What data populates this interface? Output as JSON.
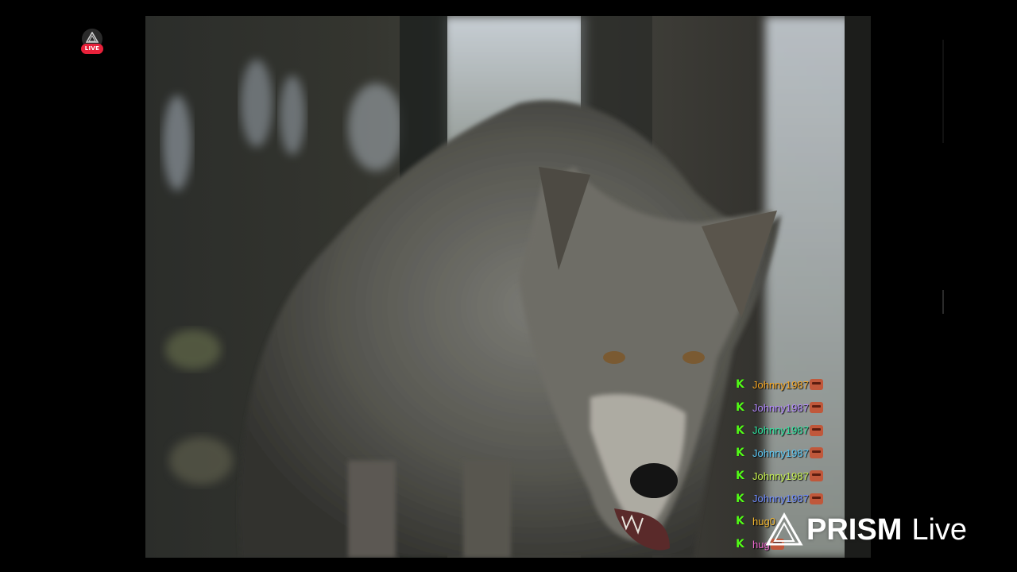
{
  "live_badge": {
    "label": "LIVE",
    "color": "#e8213a"
  },
  "video": {
    "subject": "wolf-in-forest"
  },
  "chat": {
    "platform_icon": "kick-icon",
    "messages": [
      {
        "user": "Johnny1987",
        "color": "#f5a623",
        "text": "",
        "emote": true
      },
      {
        "user": "Johnny1987",
        "color": "#b388ff",
        "text": "",
        "emote": true
      },
      {
        "user": "Johnny1987",
        "color": "#2ee6a0",
        "text": "",
        "emote": true
      },
      {
        "user": "Johnny1987",
        "color": "#5bc8f5",
        "text": "",
        "emote": true
      },
      {
        "user": "Johnny1987",
        "color": "#c6f24e",
        "text": "",
        "emote": true
      },
      {
        "user": "Johnny1987",
        "color": "#6f8cff",
        "text": "",
        "emote": true
      },
      {
        "user": "hug0",
        "color": "#f5b82e",
        "text": "",
        "emote": false
      },
      {
        "user": "hug",
        "color": "#f06ad0",
        "text": "",
        "emote": true
      }
    ]
  },
  "watermark": {
    "brand": "PRISM",
    "suffix": "Live",
    "icon": "prism-logo-icon"
  }
}
